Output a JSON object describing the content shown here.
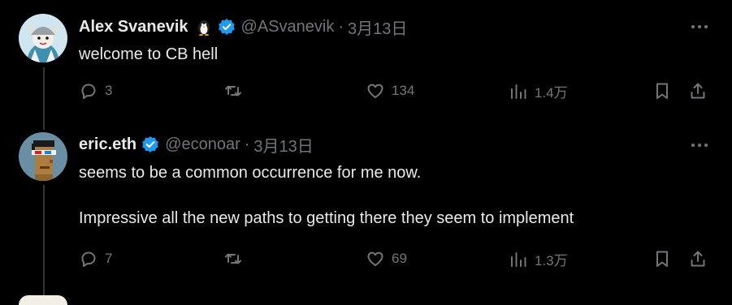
{
  "tweets": [
    {
      "name": "Alex Svanevik",
      "handle": "@ASvanevik",
      "separator": "·",
      "date": "3月13日",
      "text_lines": [
        "welcome to CB hell"
      ],
      "emoji_icon": "penguin-icon",
      "reply_count": "3",
      "retweet_count": "",
      "like_count": "134",
      "views_count": "1.4万"
    },
    {
      "name": "eric.eth",
      "handle": "@econoar",
      "separator": "·",
      "date": "3月13日",
      "text_lines": [
        "seems to be a common occurrence for me now.",
        "Impressive all the new paths to getting there they seem to implement"
      ],
      "reply_count": "7",
      "retweet_count": "",
      "like_count": "69",
      "views_count": "1.3万"
    }
  ],
  "colors": {
    "background": "#000000",
    "primary_text": "#e7e9ea",
    "secondary_text": "#71767b",
    "verified_blue": "#1d9bf0",
    "thread_line": "#333639"
  }
}
